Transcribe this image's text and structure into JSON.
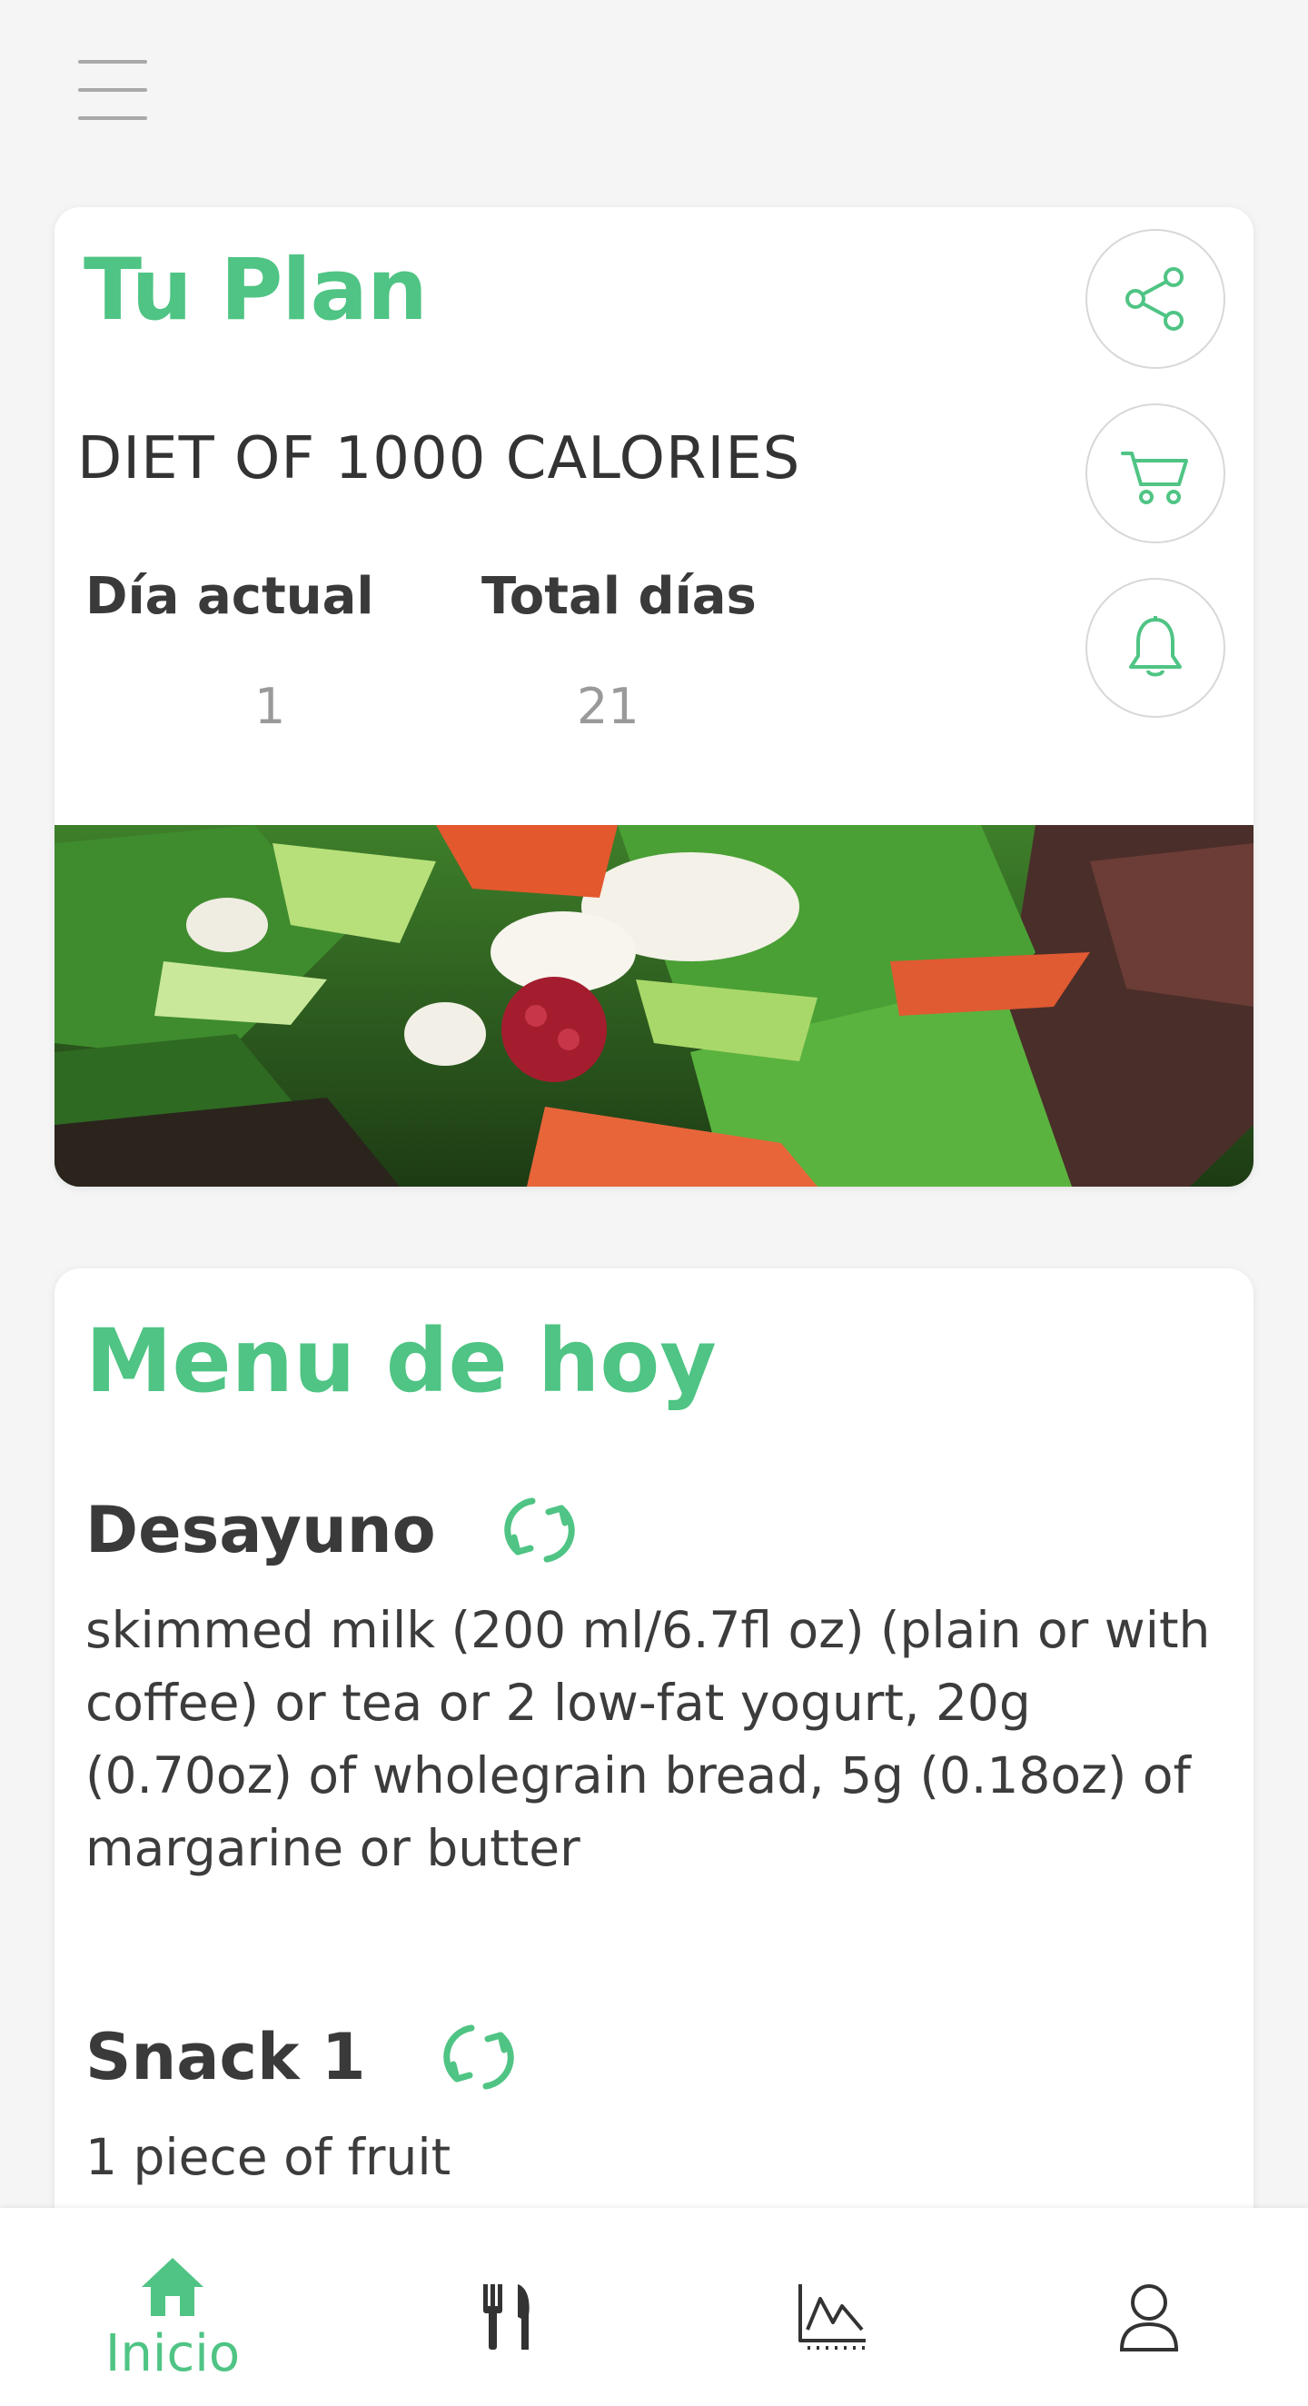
{
  "theme": {
    "accent": "#4fc484",
    "text": "#3c3c3c",
    "muted": "#9a9a9a",
    "background": "#f5f5f6"
  },
  "header": {
    "menu_icon": "hamburger-icon"
  },
  "plan": {
    "title": "Tu Plan",
    "diet_name": "DIET OF 1000 CALORIES",
    "current_day_label": "Día actual",
    "current_day_value": "1",
    "total_days_label": "Total días",
    "total_days_value": "21",
    "actions": [
      {
        "icon": "share-icon"
      },
      {
        "icon": "cart-icon"
      },
      {
        "icon": "bell-icon"
      }
    ],
    "image": "salad-photo"
  },
  "menu": {
    "title": "Menu de hoy",
    "meals": [
      {
        "name": "Desayuno",
        "description": "skimmed milk (200 ml/6.7fl oz) (plain or with coffee) or tea or 2 low-fat yogurt, 20g (0.70oz) of wholegrain bread, 5g (0.18oz) of margarine or butter"
      },
      {
        "name": "Snack 1",
        "description": "1 piece of fruit"
      }
    ]
  },
  "bottom_nav": {
    "items": [
      {
        "label": "Inicio",
        "icon": "home-icon",
        "active": true
      },
      {
        "label": "",
        "icon": "fork-knife-icon",
        "active": false
      },
      {
        "label": "",
        "icon": "chart-icon",
        "active": false
      },
      {
        "label": "",
        "icon": "profile-icon",
        "active": false
      }
    ]
  }
}
